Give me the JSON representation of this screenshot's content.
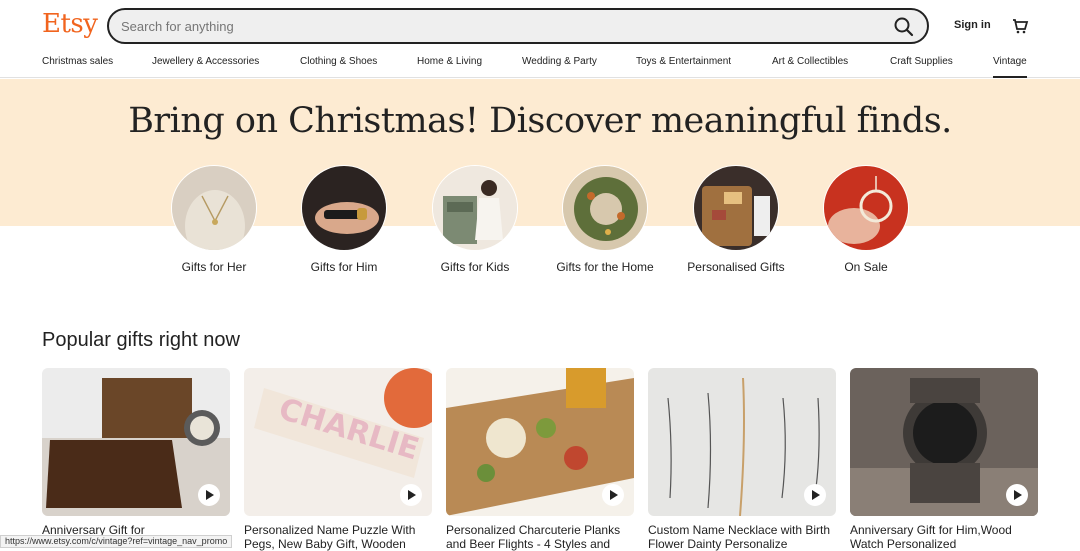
{
  "header": {
    "logo": "Etsy",
    "search_placeholder": "Search for anything",
    "signin": "Sign in"
  },
  "nav": [
    {
      "label": "Christmas sales"
    },
    {
      "label": "Jewellery & Accessories"
    },
    {
      "label": "Clothing & Shoes"
    },
    {
      "label": "Home & Living"
    },
    {
      "label": "Wedding & Party"
    },
    {
      "label": "Toys & Entertainment"
    },
    {
      "label": "Art & Collectibles"
    },
    {
      "label": "Craft Supplies"
    },
    {
      "label": "Vintage"
    }
  ],
  "hero": {
    "title": "Bring on Christmas! Discover meaningful finds.",
    "categories": [
      {
        "label": "Gifts for Her"
      },
      {
        "label": "Gifts for Him"
      },
      {
        "label": "Gifts for Kids"
      },
      {
        "label": "Gifts for the Home"
      },
      {
        "label": "Personalised Gifts"
      },
      {
        "label": "On Sale"
      }
    ]
  },
  "popular": {
    "title": "Popular gifts right now",
    "items": [
      {
        "title": "Anniversary Gift for"
      },
      {
        "title": "Personalized Name Puzzle With Pegs, New Baby Gift, Wooden"
      },
      {
        "title": "Personalized Charcuterie Planks and Beer Flights - 4 Styles and"
      },
      {
        "title": "Custom Name Necklace with Birth Flower Dainty Personalize"
      },
      {
        "title": "Anniversary Gift for Him,Wood Watch Personalized"
      }
    ]
  },
  "status_url": "https://www.etsy.com/c/vintage?ref=vintage_nav_promo",
  "colors": {
    "brand": "#f1641e",
    "hero_bg": "#fdebd2"
  }
}
